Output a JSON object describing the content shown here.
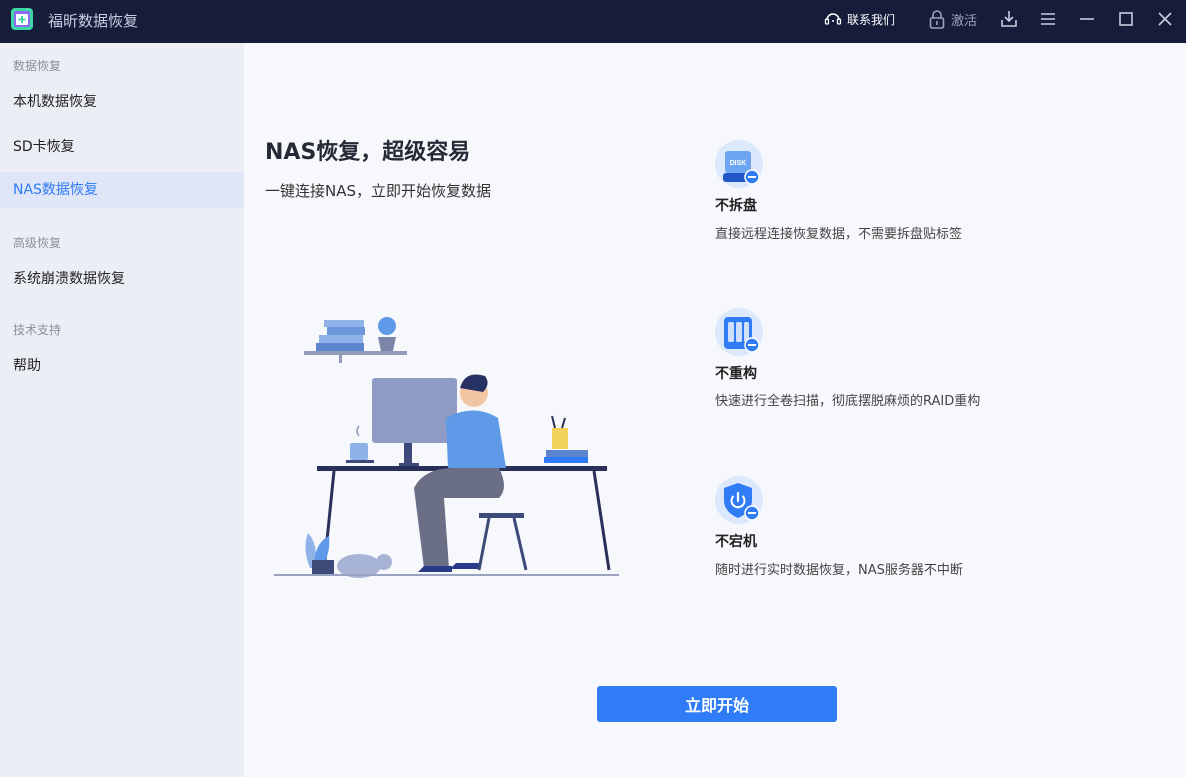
{
  "app": {
    "title": "福昕数据恢复"
  },
  "titlebar": {
    "contact_label": "联系我们",
    "activate_label": "激活",
    "icons": [
      "headset-icon",
      "lock-icon",
      "download-icon",
      "menu-icon",
      "minimize-icon",
      "maximize-icon",
      "close-icon"
    ]
  },
  "sidebar": {
    "sections": [
      {
        "label": "数据恢复",
        "items": [
          {
            "label": "本机数据恢复"
          },
          {
            "label": "SD卡恢复"
          },
          {
            "label": "NAS数据恢复",
            "active": true
          }
        ]
      },
      {
        "label": "高级恢复",
        "items": [
          {
            "label": "系统崩溃数据恢复"
          }
        ]
      },
      {
        "label": "技术支持",
        "items": [
          {
            "label": "帮助"
          }
        ]
      }
    ]
  },
  "main": {
    "headline": "NAS恢复，超级容易",
    "subline": "一键连接NAS，立即开始恢复数据",
    "features": [
      {
        "icon": "disk-icon",
        "icon_text": "DISK",
        "title": "不拆盘",
        "desc": "直接远程连接恢复数据，不需要拆盘贴标签"
      },
      {
        "icon": "nas-server-icon",
        "title": "不重构",
        "desc": "快速进行全卷扫描，彻底摆脱麻烦的RAID重构"
      },
      {
        "icon": "power-shield-icon",
        "title": "不宕机",
        "desc": "随时进行实时数据恢复，NAS服务器不中断"
      }
    ],
    "start_button": "立即开始"
  },
  "colors": {
    "titlebar_bg": "#151d3a",
    "sidebar_bg": "#eceef5",
    "active_item_bg": "#dfe6f7",
    "accent": "#2f7cf6",
    "main_bg": "#f7f8fc"
  }
}
